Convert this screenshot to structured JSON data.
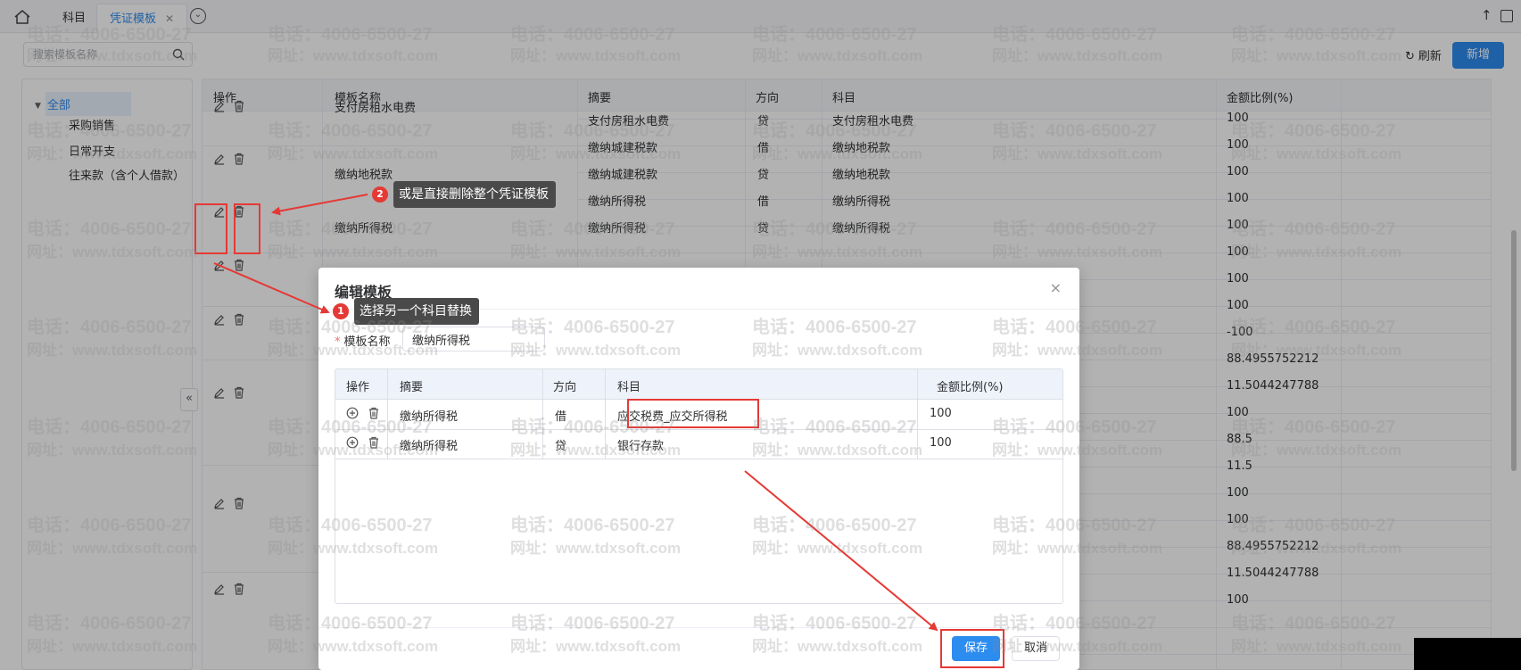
{
  "tabs": {
    "home_label": "",
    "tab1": "科目",
    "tab2": "凭证模板",
    "tab2_close": "✕"
  },
  "search": {
    "placeholder": "搜索模板名称"
  },
  "toolbar": {
    "refresh_label": "刷新",
    "add_label": "新增"
  },
  "tree": {
    "root": "全部",
    "items": [
      "采购销售",
      "日常开支",
      "往来款（含个人借款）"
    ]
  },
  "table": {
    "headers": {
      "ops": "操作",
      "name": "模板名称",
      "summary": "摘要",
      "direction": "方向",
      "account": "科目",
      "ratio": "金额比例(%)"
    },
    "names": [
      "支付房租水电费",
      "缴纳地税款",
      "缴纳所得税"
    ],
    "rows": [
      {
        "summary": "支付房租水电费",
        "direction": "贷",
        "account": "支付房租水电费",
        "ratio": "100"
      },
      {
        "summary": "缴纳城建税款",
        "direction": "借",
        "account": "缴纳地税款",
        "ratio": "100"
      },
      {
        "summary": "缴纳城建税款",
        "direction": "贷",
        "account": "缴纳地税款",
        "ratio": "100"
      },
      {
        "summary": "缴纳所得税",
        "direction": "借",
        "account": "缴纳所得税",
        "ratio": "100"
      },
      {
        "summary": "缴纳所得税",
        "direction": "贷",
        "account": "缴纳所得税",
        "ratio": "100"
      }
    ],
    "ratios_below": [
      "100",
      "100",
      "100",
      "-100",
      "88.4955752212",
      "11.5044247788",
      "100",
      "88.5",
      "11.5",
      "100",
      "100",
      "88.4955752212",
      "11.5044247788",
      "100"
    ]
  },
  "modal": {
    "title": "编辑模板",
    "close": "×",
    "name_label": "模板名称",
    "name_value": "缴纳所得税",
    "headers": {
      "ops": "操作",
      "summary": "摘要",
      "direction": "方向",
      "account": "科目",
      "ratio": "金额比例(%)"
    },
    "rows": [
      {
        "summary": "缴纳所得税",
        "direction": "借",
        "account": "应交税费_应交所得税",
        "ratio": "100"
      },
      {
        "summary": "缴纳所得税",
        "direction": "贷",
        "account": "银行存款",
        "ratio": "100"
      }
    ],
    "save_label": "保存",
    "cancel_label": "取消"
  },
  "annotations": {
    "tip1_num": "1",
    "tip1_text": "选择另一个科目替换",
    "tip2_num": "2",
    "tip2_text": "或是直接删除整个凭证模板"
  },
  "watermark": {
    "phone": "电话：4006-6500-27",
    "url": "网址：www.tdxsoft.com"
  },
  "colors": {
    "primary": "#2d8cf0",
    "annotation_red": "#e53935"
  }
}
